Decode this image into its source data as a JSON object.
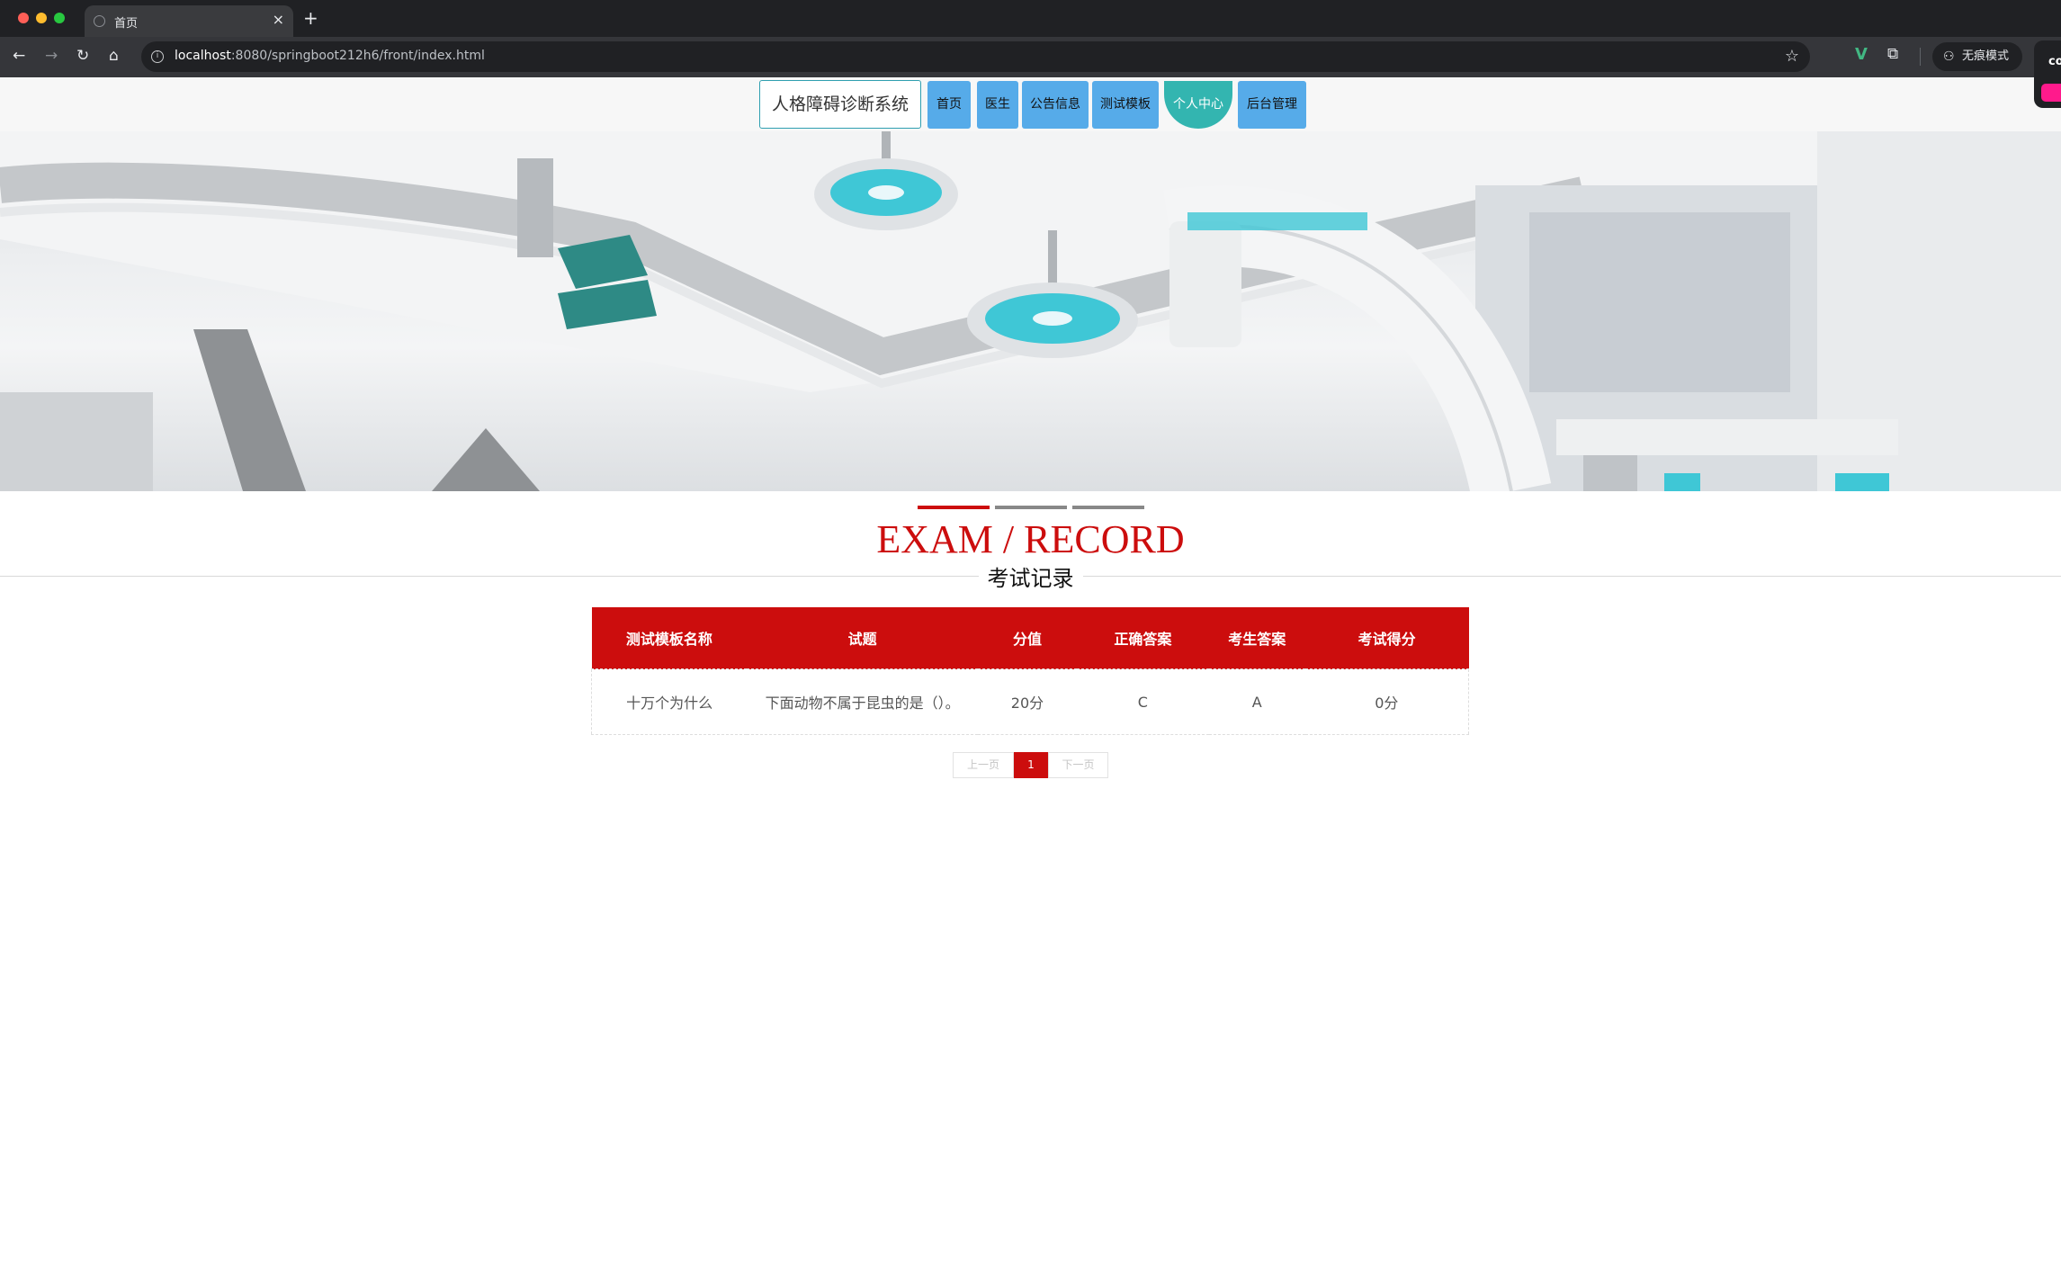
{
  "browser": {
    "tab_title": "首页",
    "tab_close": "×",
    "new_tab": "+",
    "url_host": "localhost",
    "url_rest": ":8080/springboot212h6/front/index.html",
    "incognito_label": "无痕模式",
    "float_label": "co"
  },
  "site": {
    "title": "人格障碍诊断系统",
    "nav": {
      "home": "首页",
      "doctor": "医生",
      "notice": "公告信息",
      "template": "测试模板",
      "personal": "个人中心",
      "admin": "后台管理"
    }
  },
  "section": {
    "title_en": "EXAM / RECORD",
    "title_cn": "考试记录"
  },
  "table": {
    "headers": [
      "测试模板名称",
      "试题",
      "分值",
      "正确答案",
      "考生答案",
      "考试得分"
    ],
    "rows": [
      [
        "十万个为什么",
        "下面动物不属于昆虫的是（）。",
        "20分",
        "C",
        "A",
        "0分"
      ]
    ]
  },
  "pagination": {
    "prev": "上一页",
    "current": "1",
    "next": "下一页"
  },
  "colors": {
    "accent_red": "#cc0d0d",
    "nav_blue": "#56abe9",
    "nav_active_teal": "#33b5b0"
  },
  "icons": [
    "back-icon",
    "forward-icon",
    "reload-icon",
    "home-icon",
    "info-icon",
    "star-icon",
    "vue-devtools-icon",
    "extensions-icon",
    "incognito-icon"
  ]
}
